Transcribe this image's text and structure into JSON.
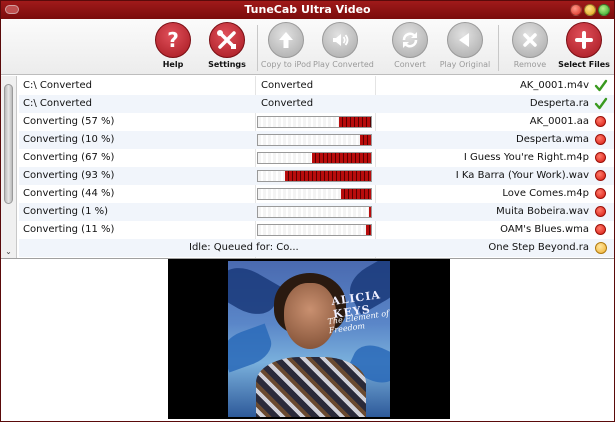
{
  "window": {
    "title": "TuneCab Ultra Video"
  },
  "toolbar": {
    "buttons": [
      {
        "label": "Help",
        "icon": "question-icon",
        "enabled": true
      },
      {
        "label": "Settings",
        "icon": "tools-icon",
        "enabled": true
      },
      {
        "label": "Copy to iPod",
        "icon": "arrow-up-icon",
        "enabled": false
      },
      {
        "label": "Play Converted",
        "icon": "speaker-icon",
        "enabled": false
      },
      {
        "label": "Convert",
        "icon": "refresh-icon",
        "enabled": false
      },
      {
        "label": "Play Original",
        "icon": "play-icon",
        "enabled": false
      },
      {
        "label": "Remove",
        "icon": "x-icon",
        "enabled": false
      },
      {
        "label": "Select Files",
        "icon": "plus-icon",
        "enabled": true
      }
    ]
  },
  "files": [
    {
      "name": "AK_0001.m4v",
      "status": "Converted",
      "destination": "C:\\ Converted",
      "state": "done",
      "progress": null
    },
    {
      "name": "Desperta.ra",
      "status": "Converted",
      "destination": "C:\\ Converted",
      "state": "done",
      "progress": null
    },
    {
      "name": "AK_0001.aa",
      "status": "",
      "destination": "Converting (57 %)",
      "state": "converting",
      "progress": 0.28
    },
    {
      "name": "Desperta.wma",
      "status": "",
      "destination": "Converting (10 %)",
      "state": "converting",
      "progress": 0.1
    },
    {
      "name": "I Guess You're Right.m4p",
      "status": "",
      "destination": "Converting (67 %)",
      "state": "converting",
      "progress": 0.52
    },
    {
      "name": "I Ka Barra (Your Work).wav",
      "status": "",
      "destination": "Converting (93 %)",
      "state": "converting",
      "progress": 0.76
    },
    {
      "name": "Love Comes.m4p",
      "status": "",
      "destination": "Converting (44 %)",
      "state": "converting",
      "progress": 0.27
    },
    {
      "name": "Muita Bobeira.wav",
      "status": "",
      "destination": "Converting (1 %)",
      "state": "converting",
      "progress": 0.02
    },
    {
      "name": "OAM's Blues.wma",
      "status": "",
      "destination": "Converting (11 %)",
      "state": "converting",
      "progress": 0.04
    },
    {
      "name": "One Step Beyond.ra",
      "status": "Idle: Queued for: Co...",
      "destination": "",
      "state": "queued",
      "progress": null
    }
  ],
  "preview": {
    "artist": "ALICIA KEYS",
    "album": "The Element of Freedom"
  },
  "colors": {
    "titlebar": "#8a1010",
    "accent_red": "#b81c22",
    "progress_fill": "#b80c0c",
    "check_green": "#3a9a20"
  }
}
